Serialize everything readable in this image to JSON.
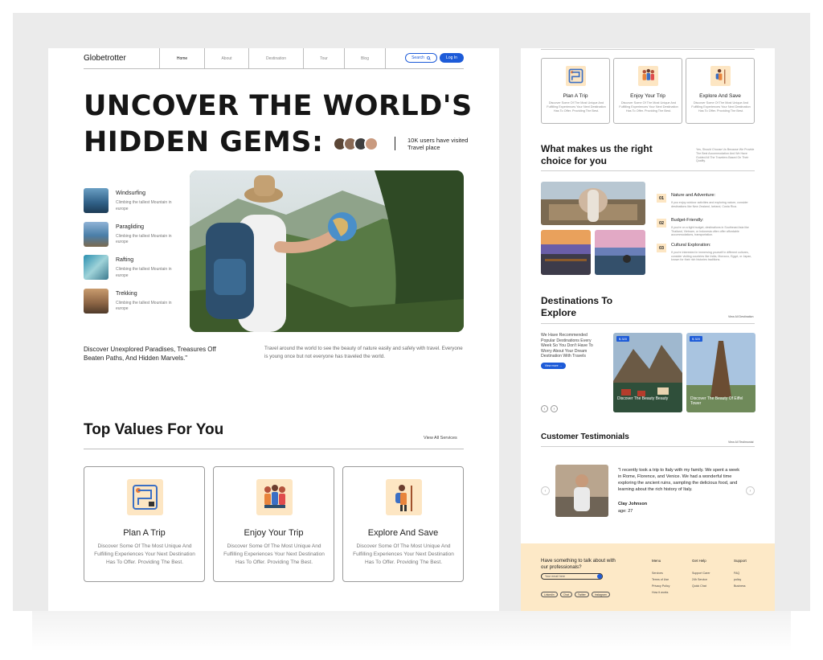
{
  "brand": "Globetrotter",
  "nav": {
    "links": [
      "Home",
      "About",
      "Destination",
      "Tour",
      "Blog"
    ],
    "search_label": "Search",
    "login_label": "Log In"
  },
  "hero": {
    "title_line1": "UNCOVER THE WORLD'S",
    "title_line2": "HIDDEN GEMS:",
    "users_text": "10K users have visited Travel place"
  },
  "activities": [
    {
      "title": "Windsurfing",
      "subtitle": "Climbing the tallest Mountain in europe"
    },
    {
      "title": "Paragliding",
      "subtitle": "Climbing the tallest Mountain in europe"
    },
    {
      "title": "Rafting",
      "subtitle": "Climbing the tallest Mountain in europe"
    },
    {
      "title": "Trekking",
      "subtitle": "Climbing the tallest Mountain in europe"
    }
  ],
  "tagline_left": "Discover Unexplored Paradises, Treasures Off Beaten Paths, And Hidden Marvels.\"",
  "tagline_right": "Travel around the world to see the beauty of nature easily and safely with travel. Everyone is young once but not everyone has traveled the world.",
  "top_values": {
    "title": "Top Values For You",
    "view_all": "View All Services",
    "cards": [
      {
        "title": "Plan A Trip",
        "desc": "Discover Some Of The Most Unique And Fulfilling Experiences Your Next Destination Has To Offer. Providing The Best."
      },
      {
        "title": "Enjoy Your Trip",
        "desc": "Discover Some Of The Most Unique And Fulfilling Experiences Your Next Destination Has To Offer. Providing The Best."
      },
      {
        "title": "Explore And Save",
        "desc": "Discover Some Of The Most Unique And Fulfilling Experiences Your Next Destination Has To Offer. Providing The Best."
      }
    ]
  },
  "why": {
    "title": "What makes us the right choice for you",
    "note": "Yes, Should Choose Us Because We Provide The Best Accommodation And We Have Guided All The Travelers Based On Their Quality.",
    "reasons": [
      {
        "num": "01",
        "title": "Nature and Adventure:",
        "desc": "If you enjoy outdoor activities and exploring nature, consider destinations like New Zealand, Iceland, Costa Rica."
      },
      {
        "num": "02",
        "title": "Budget-Friendly:",
        "desc": "If you're on a tight budget, destinations in Southeast Asia like Thailand, Vietnam, or Indonesia often offer affordable accommodations, transportation."
      },
      {
        "num": "03",
        "title": "Cultural Exploration:",
        "desc": "If you're interested in immersing yourself in different cultures, consider visiting countries like India, Morocco, Egypt, or Japan, known for their rich histories traditions."
      }
    ]
  },
  "destinations": {
    "title": "Destinations To Explore",
    "view_all": "View All Destination",
    "desc": "We Have Recommended Popular Destinations Every Week So You Don't Have To Worry About Your Dream Destination With Travels",
    "more_label": "View more",
    "cards": [
      {
        "price": "$ 320",
        "name": "Discover The Beauty Beauty"
      },
      {
        "price": "$ 320",
        "name": "Discover The Beauty Of Eiffel Tower"
      }
    ]
  },
  "testimonials": {
    "title": "Customer Testimonials",
    "view_all": "View All Testimonial",
    "quote": "\"I recently took a trip to Italy with my family. We spent a week in Rome, Florence, and Venice. We had a wonderful time exploring the ancient ruins, sampling the delicious food, and learning about the rich history of Italy.",
    "name": "Clay Johnson",
    "age": "age: 27"
  },
  "footer": {
    "cta": "Have something to talk about with our professionals?",
    "email_placeholder": "Your email here",
    "socials": [
      "Linkedin",
      "Chat",
      "Twitter",
      "Instagram"
    ],
    "columns": [
      {
        "heading": "Menu",
        "items": [
          "Services",
          "Terms of Use",
          "Privacy Policy",
          "How it works"
        ]
      },
      {
        "heading": "Get Help",
        "items": [
          "Support Carer",
          "24h Service",
          "Quick Chat"
        ]
      },
      {
        "heading": "Support",
        "items": [
          "FAQ",
          "policy",
          "Business"
        ]
      }
    ]
  },
  "colors": {
    "accent": "#1d5bd8",
    "peach": "#fde6c3",
    "footer_bg": "#fde9c7"
  }
}
